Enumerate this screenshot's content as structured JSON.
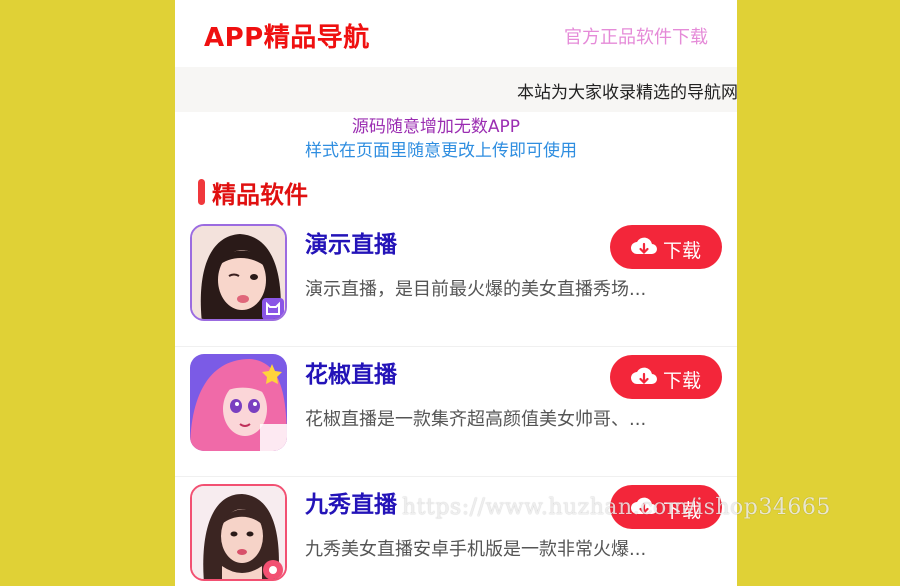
{
  "header": {
    "logo": "APP精品导航",
    "link": "官方正品软件下载"
  },
  "marquee": {
    "text": "本站为大家收录精选的导航网"
  },
  "notice": {
    "line1": "源码随意增加无数APP",
    "line2": "样式在页面里随意更改上传即可使用"
  },
  "section": {
    "title": "精品软件"
  },
  "apps": [
    {
      "name": "演示直播",
      "desc": "演示直播，是目前最火爆的美女直播秀场...",
      "button": "下载",
      "icon": "avatar-girl-wink-icon"
    },
    {
      "name": "花椒直播",
      "desc": "花椒直播是一款集齐超高颜值美女帅哥、...",
      "button": "下载",
      "icon": "cartoon-girl-pink-hair-icon"
    },
    {
      "name": "九秀直播",
      "desc": "九秀美女直播安卓手机版是一款非常火爆...",
      "button": "下载",
      "icon": "avatar-woman-icon"
    }
  ],
  "watermark": "https://www.huzhan.com/ishop34665",
  "colors": {
    "background": "#e0d136",
    "accent": "#f3263a",
    "logo": "#ef1010",
    "app_name": "#2313b8",
    "link": "#e58bd8"
  }
}
